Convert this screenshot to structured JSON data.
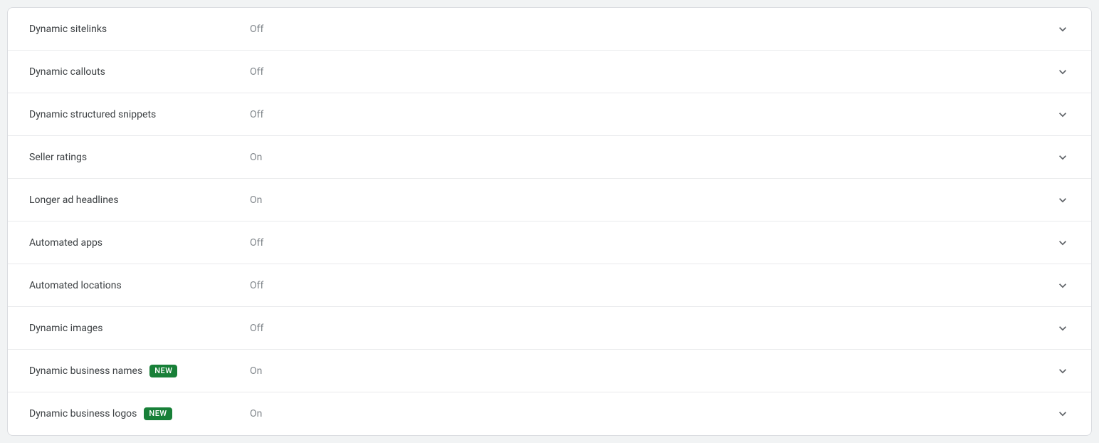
{
  "badge_text": "NEW",
  "settings": [
    {
      "label": "Dynamic sitelinks",
      "value": "Off",
      "badge": false
    },
    {
      "label": "Dynamic callouts",
      "value": "Off",
      "badge": false
    },
    {
      "label": "Dynamic structured snippets",
      "value": "Off",
      "badge": false
    },
    {
      "label": "Seller ratings",
      "value": "On",
      "badge": false
    },
    {
      "label": "Longer ad headlines",
      "value": "On",
      "badge": false
    },
    {
      "label": "Automated apps",
      "value": "Off",
      "badge": false
    },
    {
      "label": "Automated locations",
      "value": "Off",
      "badge": false
    },
    {
      "label": "Dynamic images",
      "value": "Off",
      "badge": false
    },
    {
      "label": "Dynamic business names",
      "value": "On",
      "badge": true
    },
    {
      "label": "Dynamic business logos",
      "value": "On",
      "badge": true
    }
  ]
}
